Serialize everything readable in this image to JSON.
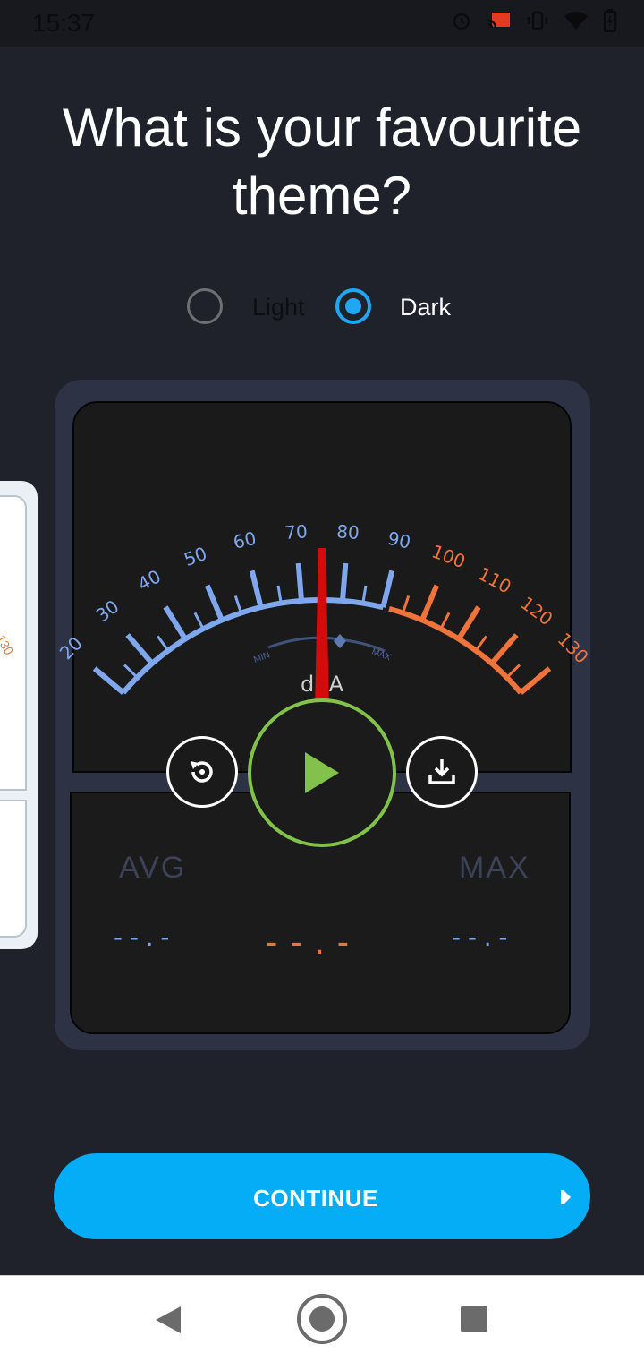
{
  "status_bar": {
    "time": "15:37",
    "icons": [
      "alarm-icon",
      "cast-icon",
      "vibrate-icon",
      "wifi-icon",
      "battery-icon"
    ]
  },
  "title": "What is your favourite theme?",
  "theme_options": {
    "options": [
      {
        "label": "Light",
        "selected": false
      },
      {
        "label": "Dark",
        "selected": true
      }
    ]
  },
  "gauge": {
    "scale_blue": [
      "20",
      "30",
      "40",
      "50",
      "60",
      "70",
      "80",
      "90"
    ],
    "scale_orange": [
      "100",
      "110",
      "120",
      "130"
    ],
    "min_label": "MIN",
    "max_label": "MAX",
    "unit": "dBA",
    "needle_value": 75,
    "colors": {
      "blue": "#7fa7ee",
      "orange": "#f0733c",
      "needle": "#d40b0b",
      "play": "#82c24a"
    }
  },
  "stats": {
    "avg_label": "AVG",
    "max_label": "MAX",
    "avg_value": "--.-",
    "current_value": "--.-",
    "max_value": "--.-"
  },
  "side_card": {
    "number": "130"
  },
  "continue_button": {
    "label": "CONTINUE"
  },
  "navigation": [
    "back-icon",
    "home-icon",
    "recents-icon"
  ]
}
